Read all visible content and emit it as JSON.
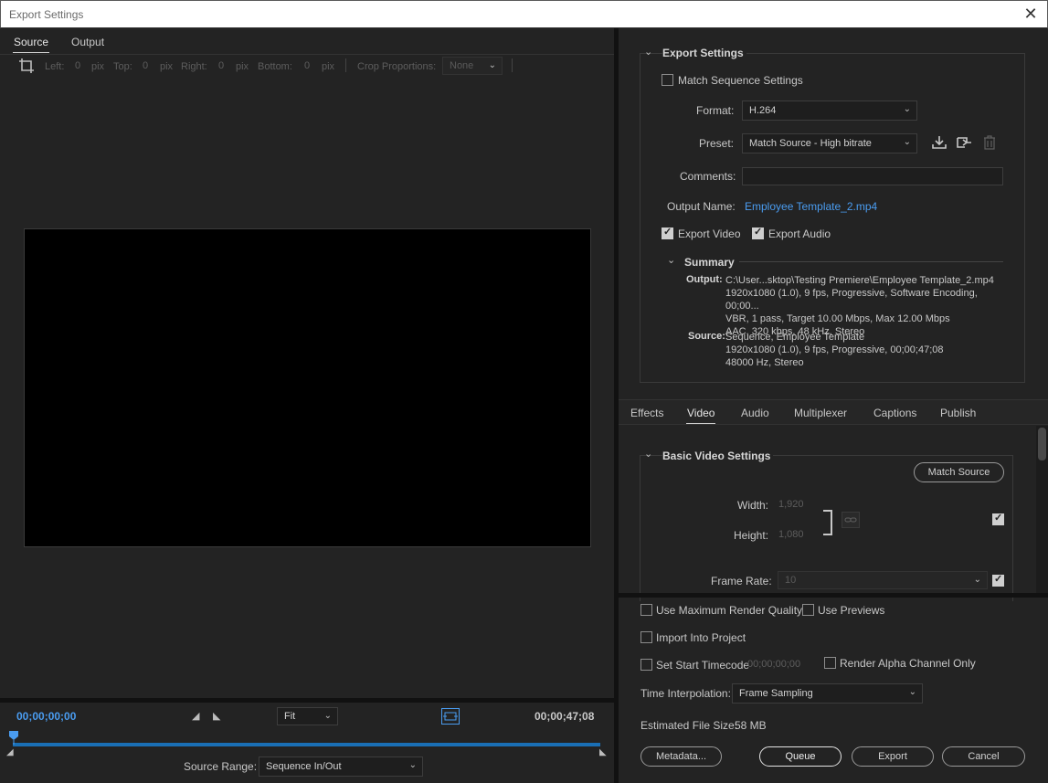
{
  "window": {
    "title": "Export Settings"
  },
  "source_tabs": [
    {
      "label": "Source",
      "active": true
    },
    {
      "label": "Output",
      "active": false
    }
  ],
  "crop": {
    "left_label": "Left:",
    "left_value": "0",
    "left_unit": "pix",
    "top_label": "Top:",
    "top_value": "0",
    "top_unit": "pix",
    "right_label": "Right:",
    "right_value": "0",
    "right_unit": "pix",
    "bottom_label": "Bottom:",
    "bottom_value": "0",
    "bottom_unit": "pix",
    "proportions_label": "Crop Proportions:",
    "proportions_value": "None"
  },
  "playback": {
    "current_timecode": "00;00;00;00",
    "end_timecode": "00;00;47;08",
    "zoom": "Fit",
    "source_range_label": "Source Range:",
    "source_range_value": "Sequence In/Out",
    "progress_fraction": 0.0
  },
  "export_settings": {
    "section_title": "Export Settings",
    "match_sequence_label": "Match Sequence Settings",
    "match_sequence_checked": false,
    "format_label": "Format:",
    "format_value": "H.264",
    "preset_label": "Preset:",
    "preset_value": "Match Source - High bitrate",
    "comments_label": "Comments:",
    "comments_value": "",
    "output_name_label": "Output Name:",
    "output_name_value": "Employee Template_2.mp4",
    "export_video_label": "Export Video",
    "export_video_checked": true,
    "export_audio_label": "Export Audio",
    "export_audio_checked": true
  },
  "summary": {
    "title": "Summary",
    "output_label": "Output:",
    "output_lines": [
      "C:\\User...sktop\\Testing Premiere\\Employee Template_2.mp4",
      "1920x1080 (1.0), 9 fps, Progressive, Software Encoding, 00;00...",
      "VBR, 1 pass, Target 10.00 Mbps, Max 12.00 Mbps",
      "AAC, 320 kbps, 48 kHz, Stereo"
    ],
    "source_label": "Source:",
    "source_lines": [
      "Sequence, Employee Template",
      "1920x1080 (1.0), 9 fps, Progressive, 00;00;47;08",
      "48000 Hz, Stereo"
    ]
  },
  "settings_tabs": [
    {
      "label": "Effects",
      "active": false
    },
    {
      "label": "Video",
      "active": true
    },
    {
      "label": "Audio",
      "active": false
    },
    {
      "label": "Multiplexer",
      "active": false
    },
    {
      "label": "Captions",
      "active": false
    },
    {
      "label": "Publish",
      "active": false
    }
  ],
  "basic_video": {
    "section_title": "Basic Video Settings",
    "match_source_button": "Match Source",
    "width_label": "Width:",
    "width_value": "1,920",
    "height_label": "Height:",
    "height_value": "1,080",
    "frame_rate_label": "Frame Rate:",
    "frame_rate_value": "10"
  },
  "bottom_options": {
    "max_render_quality_label": "Use Maximum Render Quality",
    "use_previews_label": "Use Previews",
    "import_into_project_label": "Import Into Project",
    "set_start_timecode_label": "Set Start Timecode",
    "start_timecode_value": "00;00;00;00",
    "render_alpha_label": "Render Alpha Channel Only",
    "time_interpolation_label": "Time Interpolation:",
    "time_interpolation_value": "Frame Sampling",
    "estimated_file_size_label": "Estimated File Size:",
    "estimated_file_size_value": "58 MB"
  },
  "buttons": {
    "metadata": "Metadata...",
    "queue": "Queue",
    "export": "Export",
    "cancel": "Cancel"
  },
  "colors": {
    "accent_blue": "#4a9cf0",
    "timeline_blue": "#1a6fb5",
    "background": "#232323"
  }
}
